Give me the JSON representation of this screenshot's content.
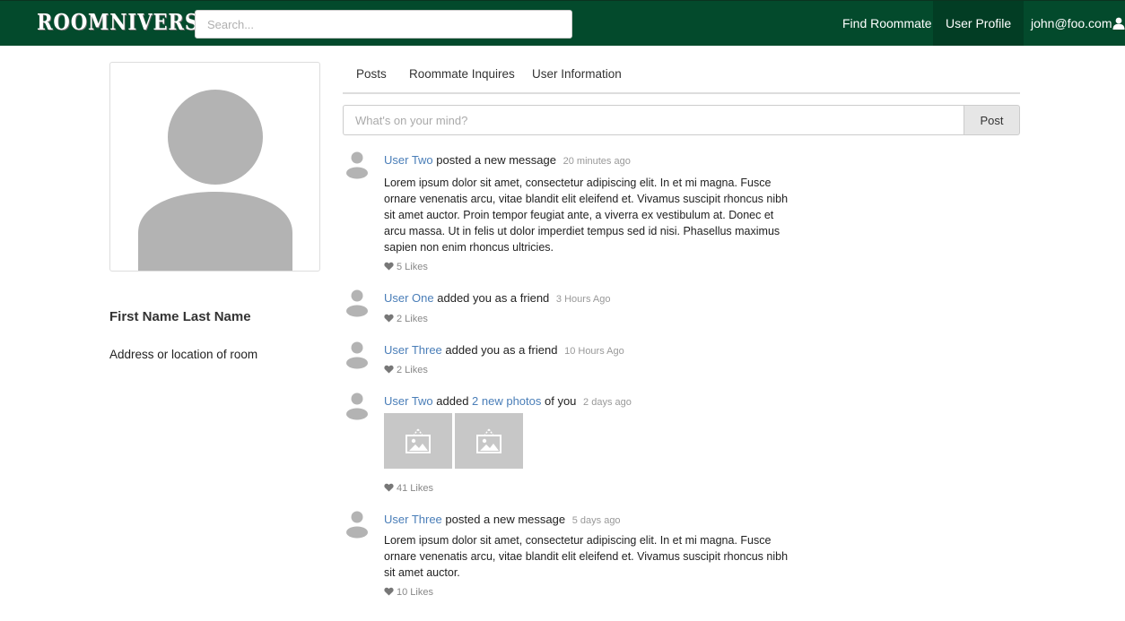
{
  "navbar": {
    "brand": "ROOMNIVERSE",
    "search_placeholder": "Search...",
    "links": [
      {
        "label": "Find Roommate"
      },
      {
        "label": "User Profile"
      },
      {
        "label": "john@foo.com"
      }
    ]
  },
  "profile": {
    "name": "First Name Last Name",
    "address": "Address or location of room"
  },
  "tabs": [
    {
      "label": "Posts"
    },
    {
      "label": "Roommate Inquires"
    },
    {
      "label": "User Information"
    }
  ],
  "composer": {
    "placeholder": "What's on your mind?",
    "button_label": "Post"
  },
  "feed": [
    {
      "user": "User Two",
      "action": " posted a new message",
      "date": "20 minutes ago",
      "text": "Lorem ipsum dolor sit amet, consectetur adipiscing elit. In et mi magna. Fusce ornare venenatis arcu, vitae blandit elit eleifend et. Vivamus suscipit rhoncus nibh sit amet auctor. Proin tempor feugiat ante, a viverra ex vestibulum at. Donec et arcu massa. Ut in felis ut dolor imperdiet tempus sed id nisi. Phasellus maximus sapien non enim rhoncus ultricies.",
      "likes": "5 Likes"
    },
    {
      "user": "User One",
      "action": " added you as a friend",
      "date": "3 Hours Ago",
      "likes": "2 Likes"
    },
    {
      "user": "User Three",
      "action": " added you as a friend",
      "date": "10 Hours Ago",
      "likes": "2 Likes"
    },
    {
      "user": "User Two",
      "action_prefix": " added ",
      "action_link": "2 new photos",
      "action_suffix": " of you",
      "date": "2 days ago",
      "likes": "41 Likes"
    },
    {
      "user": "User Three",
      "action": " posted a new message",
      "date": "5 days ago",
      "text": "Lorem ipsum dolor sit amet, consectetur adipiscing elit. In et mi magna. Fusce ornare venenatis arcu, vitae blandit elit eleifend et. Vivamus suscipit rhoncus nibh sit amet auctor.",
      "likes": "10 Likes"
    }
  ],
  "icons": {
    "avatar": "user-silhouette-icon",
    "user": "user-icon",
    "heart": "heart-icon",
    "photo": "image-placeholder-icon"
  },
  "colors": {
    "navbar": "#034a2c",
    "link": "#4a7eb8",
    "placeholder_gray": "#b3b3b3"
  }
}
